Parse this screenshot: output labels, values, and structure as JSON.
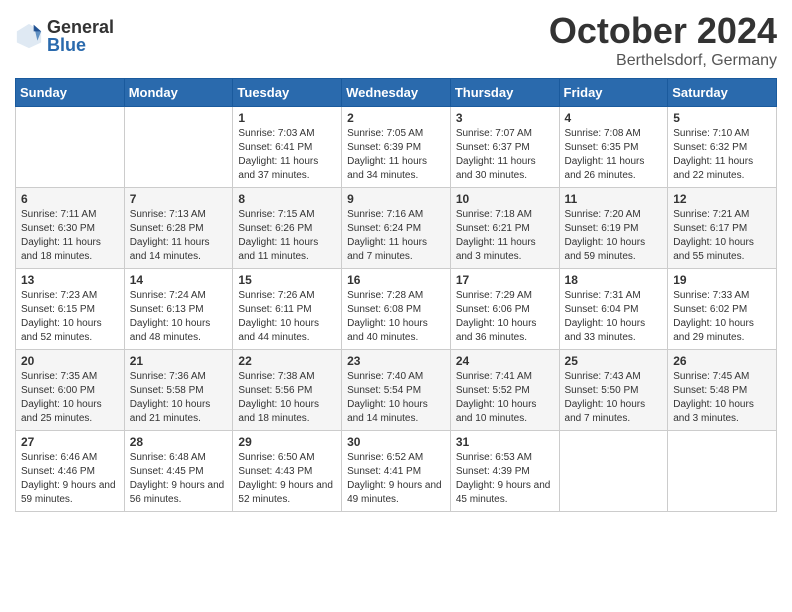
{
  "header": {
    "logo_general": "General",
    "logo_blue": "Blue",
    "month_title": "October 2024",
    "location": "Berthelsdorf, Germany"
  },
  "days_of_week": [
    "Sunday",
    "Monday",
    "Tuesday",
    "Wednesday",
    "Thursday",
    "Friday",
    "Saturday"
  ],
  "weeks": [
    [
      {
        "day": "",
        "sunrise": "",
        "sunset": "",
        "daylight": ""
      },
      {
        "day": "",
        "sunrise": "",
        "sunset": "",
        "daylight": ""
      },
      {
        "day": "1",
        "sunrise": "Sunrise: 7:03 AM",
        "sunset": "Sunset: 6:41 PM",
        "daylight": "Daylight: 11 hours and 37 minutes."
      },
      {
        "day": "2",
        "sunrise": "Sunrise: 7:05 AM",
        "sunset": "Sunset: 6:39 PM",
        "daylight": "Daylight: 11 hours and 34 minutes."
      },
      {
        "day": "3",
        "sunrise": "Sunrise: 7:07 AM",
        "sunset": "Sunset: 6:37 PM",
        "daylight": "Daylight: 11 hours and 30 minutes."
      },
      {
        "day": "4",
        "sunrise": "Sunrise: 7:08 AM",
        "sunset": "Sunset: 6:35 PM",
        "daylight": "Daylight: 11 hours and 26 minutes."
      },
      {
        "day": "5",
        "sunrise": "Sunrise: 7:10 AM",
        "sunset": "Sunset: 6:32 PM",
        "daylight": "Daylight: 11 hours and 22 minutes."
      }
    ],
    [
      {
        "day": "6",
        "sunrise": "Sunrise: 7:11 AM",
        "sunset": "Sunset: 6:30 PM",
        "daylight": "Daylight: 11 hours and 18 minutes."
      },
      {
        "day": "7",
        "sunrise": "Sunrise: 7:13 AM",
        "sunset": "Sunset: 6:28 PM",
        "daylight": "Daylight: 11 hours and 14 minutes."
      },
      {
        "day": "8",
        "sunrise": "Sunrise: 7:15 AM",
        "sunset": "Sunset: 6:26 PM",
        "daylight": "Daylight: 11 hours and 11 minutes."
      },
      {
        "day": "9",
        "sunrise": "Sunrise: 7:16 AM",
        "sunset": "Sunset: 6:24 PM",
        "daylight": "Daylight: 11 hours and 7 minutes."
      },
      {
        "day": "10",
        "sunrise": "Sunrise: 7:18 AM",
        "sunset": "Sunset: 6:21 PM",
        "daylight": "Daylight: 11 hours and 3 minutes."
      },
      {
        "day": "11",
        "sunrise": "Sunrise: 7:20 AM",
        "sunset": "Sunset: 6:19 PM",
        "daylight": "Daylight: 10 hours and 59 minutes."
      },
      {
        "day": "12",
        "sunrise": "Sunrise: 7:21 AM",
        "sunset": "Sunset: 6:17 PM",
        "daylight": "Daylight: 10 hours and 55 minutes."
      }
    ],
    [
      {
        "day": "13",
        "sunrise": "Sunrise: 7:23 AM",
        "sunset": "Sunset: 6:15 PM",
        "daylight": "Daylight: 10 hours and 52 minutes."
      },
      {
        "day": "14",
        "sunrise": "Sunrise: 7:24 AM",
        "sunset": "Sunset: 6:13 PM",
        "daylight": "Daylight: 10 hours and 48 minutes."
      },
      {
        "day": "15",
        "sunrise": "Sunrise: 7:26 AM",
        "sunset": "Sunset: 6:11 PM",
        "daylight": "Daylight: 10 hours and 44 minutes."
      },
      {
        "day": "16",
        "sunrise": "Sunrise: 7:28 AM",
        "sunset": "Sunset: 6:08 PM",
        "daylight": "Daylight: 10 hours and 40 minutes."
      },
      {
        "day": "17",
        "sunrise": "Sunrise: 7:29 AM",
        "sunset": "Sunset: 6:06 PM",
        "daylight": "Daylight: 10 hours and 36 minutes."
      },
      {
        "day": "18",
        "sunrise": "Sunrise: 7:31 AM",
        "sunset": "Sunset: 6:04 PM",
        "daylight": "Daylight: 10 hours and 33 minutes."
      },
      {
        "day": "19",
        "sunrise": "Sunrise: 7:33 AM",
        "sunset": "Sunset: 6:02 PM",
        "daylight": "Daylight: 10 hours and 29 minutes."
      }
    ],
    [
      {
        "day": "20",
        "sunrise": "Sunrise: 7:35 AM",
        "sunset": "Sunset: 6:00 PM",
        "daylight": "Daylight: 10 hours and 25 minutes."
      },
      {
        "day": "21",
        "sunrise": "Sunrise: 7:36 AM",
        "sunset": "Sunset: 5:58 PM",
        "daylight": "Daylight: 10 hours and 21 minutes."
      },
      {
        "day": "22",
        "sunrise": "Sunrise: 7:38 AM",
        "sunset": "Sunset: 5:56 PM",
        "daylight": "Daylight: 10 hours and 18 minutes."
      },
      {
        "day": "23",
        "sunrise": "Sunrise: 7:40 AM",
        "sunset": "Sunset: 5:54 PM",
        "daylight": "Daylight: 10 hours and 14 minutes."
      },
      {
        "day": "24",
        "sunrise": "Sunrise: 7:41 AM",
        "sunset": "Sunset: 5:52 PM",
        "daylight": "Daylight: 10 hours and 10 minutes."
      },
      {
        "day": "25",
        "sunrise": "Sunrise: 7:43 AM",
        "sunset": "Sunset: 5:50 PM",
        "daylight": "Daylight: 10 hours and 7 minutes."
      },
      {
        "day": "26",
        "sunrise": "Sunrise: 7:45 AM",
        "sunset": "Sunset: 5:48 PM",
        "daylight": "Daylight: 10 hours and 3 minutes."
      }
    ],
    [
      {
        "day": "27",
        "sunrise": "Sunrise: 6:46 AM",
        "sunset": "Sunset: 4:46 PM",
        "daylight": "Daylight: 9 hours and 59 minutes."
      },
      {
        "day": "28",
        "sunrise": "Sunrise: 6:48 AM",
        "sunset": "Sunset: 4:45 PM",
        "daylight": "Daylight: 9 hours and 56 minutes."
      },
      {
        "day": "29",
        "sunrise": "Sunrise: 6:50 AM",
        "sunset": "Sunset: 4:43 PM",
        "daylight": "Daylight: 9 hours and 52 minutes."
      },
      {
        "day": "30",
        "sunrise": "Sunrise: 6:52 AM",
        "sunset": "Sunset: 4:41 PM",
        "daylight": "Daylight: 9 hours and 49 minutes."
      },
      {
        "day": "31",
        "sunrise": "Sunrise: 6:53 AM",
        "sunset": "Sunset: 4:39 PM",
        "daylight": "Daylight: 9 hours and 45 minutes."
      },
      {
        "day": "",
        "sunrise": "",
        "sunset": "",
        "daylight": ""
      },
      {
        "day": "",
        "sunrise": "",
        "sunset": "",
        "daylight": ""
      }
    ]
  ]
}
